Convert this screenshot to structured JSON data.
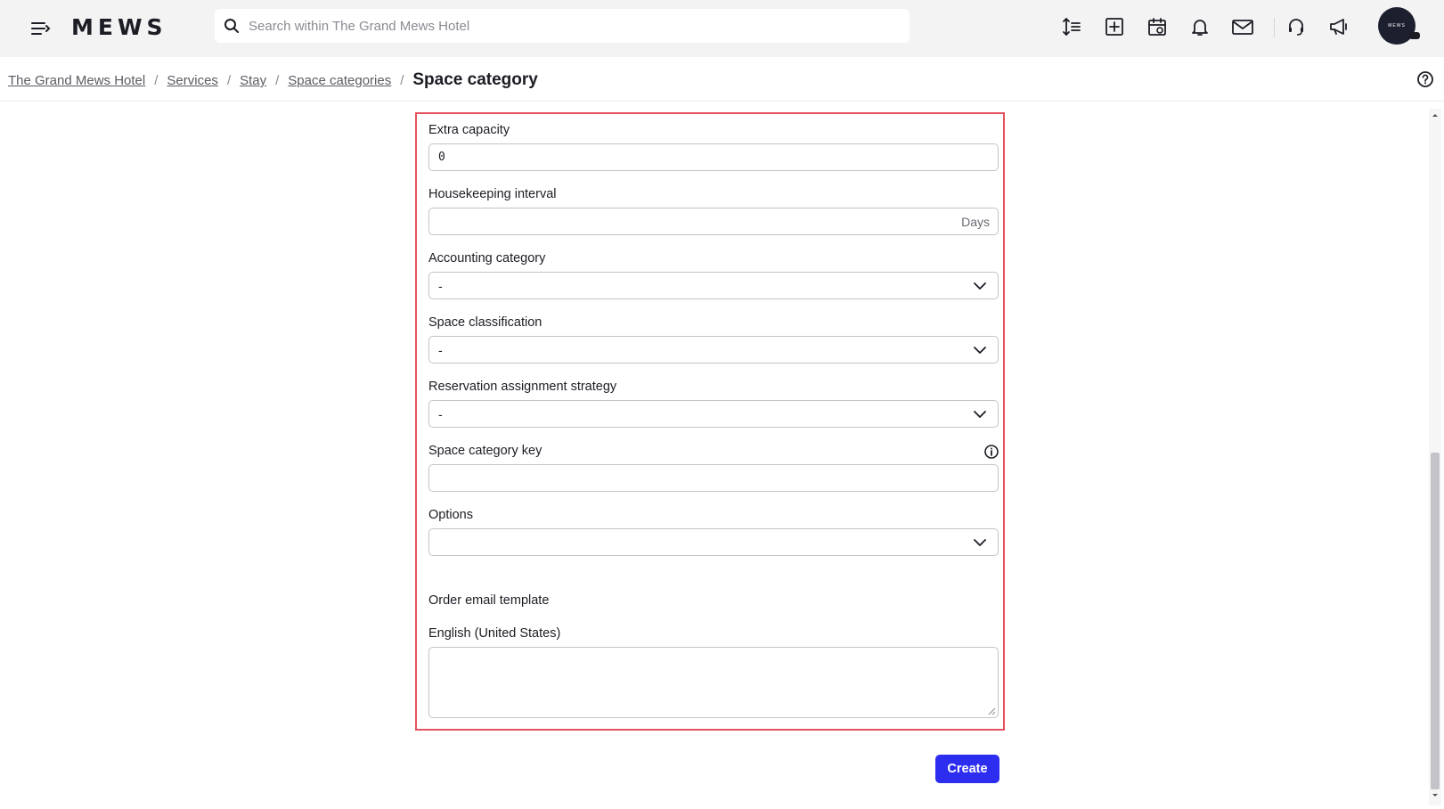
{
  "topbar": {
    "logo": "MEWS",
    "search_placeholder": "Search within The Grand Mews Hotel",
    "avatar_text": "MEWS",
    "icons": [
      "menu-icon",
      "sort-icon",
      "add-icon",
      "calendar-icon",
      "bell-icon",
      "mail-icon",
      "headset-icon",
      "megaphone-icon"
    ]
  },
  "breadcrumb": {
    "items": [
      "The Grand Mews Hotel",
      "Services",
      "Stay",
      "Space categories"
    ],
    "separator": "/",
    "current": "Space category"
  },
  "form": {
    "extra_capacity": {
      "label": "Extra capacity",
      "value": "0"
    },
    "housekeeping_interval": {
      "label": "Housekeeping interval",
      "value": "",
      "suffix": "Days"
    },
    "accounting_category": {
      "label": "Accounting category",
      "value": "-"
    },
    "space_classification": {
      "label": "Space classification",
      "value": "-"
    },
    "reservation_assignment_strategy": {
      "label": "Reservation assignment strategy",
      "value": "-"
    },
    "space_category_key": {
      "label": "Space category key",
      "value": ""
    },
    "options": {
      "label": "Options",
      "value": ""
    },
    "order_email_template": {
      "heading": "Order email template",
      "language_label": "English (United States)",
      "value": ""
    }
  },
  "actions": {
    "create_label": "Create"
  },
  "colors": {
    "accent": "#2d2df0",
    "highlight_border": "#e5535f",
    "topbar_bg": "#f3f3f4"
  }
}
